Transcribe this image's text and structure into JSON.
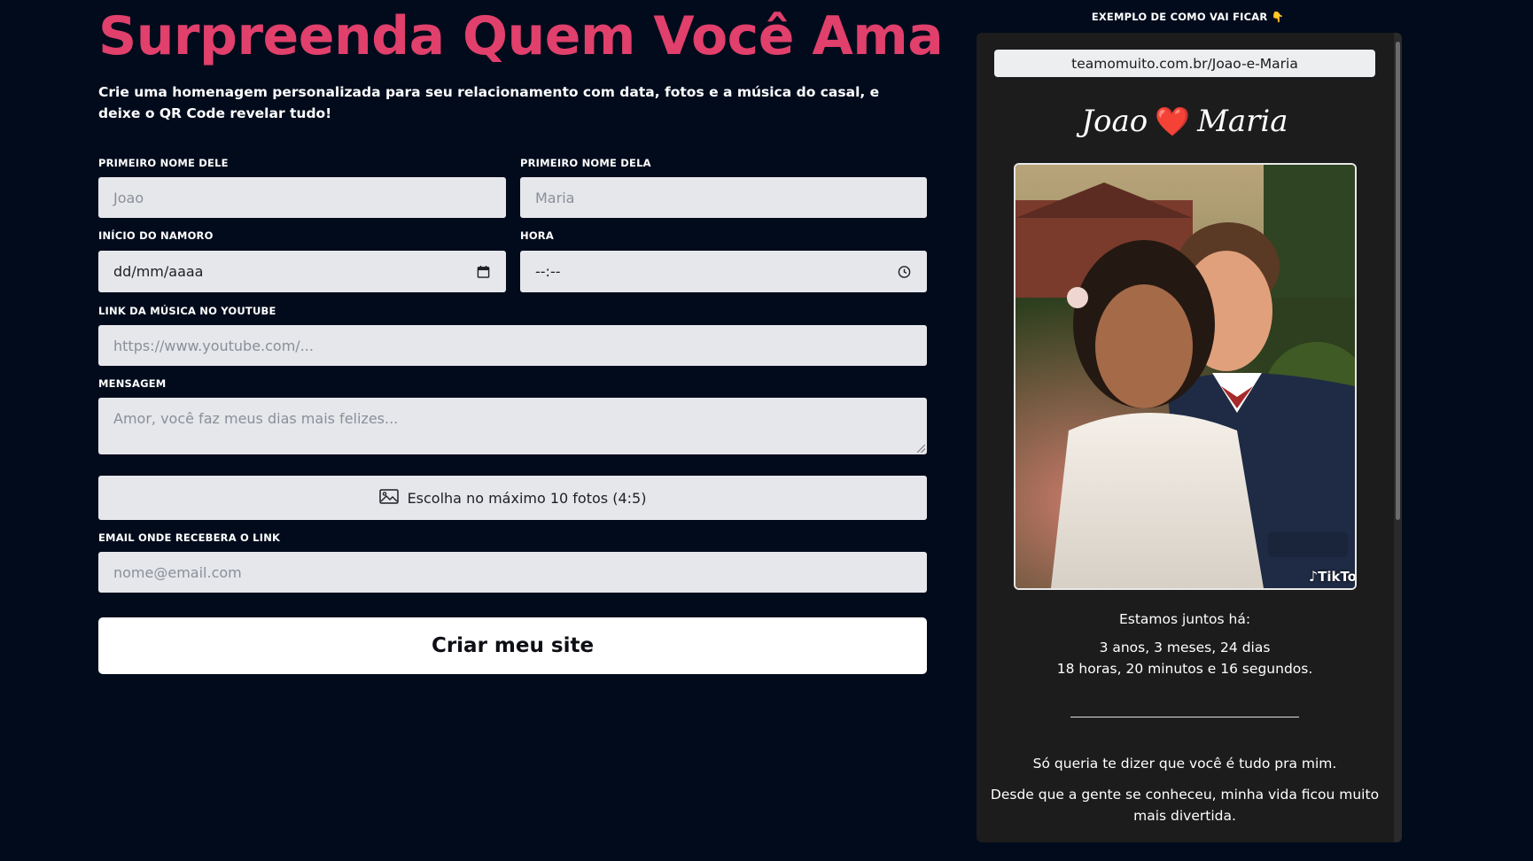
{
  "header": {
    "title": "Surpreenda Quem Você Ama",
    "subtitle": "Crie uma homenagem personalizada para seu relacionamento com data, fotos e a música do casal, e deixe o QR Code revelar tudo!"
  },
  "form": {
    "his_name": {
      "label": "PRIMEIRO NOME DELE",
      "placeholder": "Joao"
    },
    "her_name": {
      "label": "PRIMEIRO NOME DELA",
      "placeholder": "Maria"
    },
    "start_date": {
      "label": "INÍCIO DO NAMORO",
      "value": "dd/mm/aaaa"
    },
    "time": {
      "label": "HORA",
      "value": "--:--"
    },
    "music_link": {
      "label": "LINK DA MÚSICA NO YOUTUBE",
      "placeholder": "https://www.youtube.com/..."
    },
    "message": {
      "label": "MENSAGEM",
      "placeholder": "Amor, você faz meus dias mais felizes..."
    },
    "photos_button": "Escolha no máximo 10 fotos (4:5)",
    "email": {
      "label": "EMAIL ONDE RECEBERA O LINK",
      "placeholder": "nome@email.com"
    },
    "submit": "Criar meu site"
  },
  "preview": {
    "label": "EXEMPLO DE COMO VAI FICAR 👇",
    "url": "teamomuito.com.br/Joao-e-Maria",
    "name_left": "Joao",
    "heart": "❤️",
    "name_right": "Maria",
    "photo_watermark": "TikTo",
    "together_title": "Estamos juntos há:",
    "together_line1": "3 anos, 3 meses, 24 dias",
    "together_line2": "18 horas, 20 minutos e 16 segundos.",
    "message_line1": "Só queria te dizer que você é tudo pra mim.",
    "message_line2": "Desde que a gente se conheceu, minha vida ficou muito",
    "message_line3": "mais divertida."
  },
  "colors": {
    "background": "#020b1c",
    "title": "#e0406b",
    "field": "#e6e7eb",
    "preview_panel": "#1c1c1c"
  },
  "icons": {
    "calendar": "calendar-icon",
    "clock": "clock-icon",
    "image": "image-icon",
    "tiktok": "tiktok-icon"
  }
}
